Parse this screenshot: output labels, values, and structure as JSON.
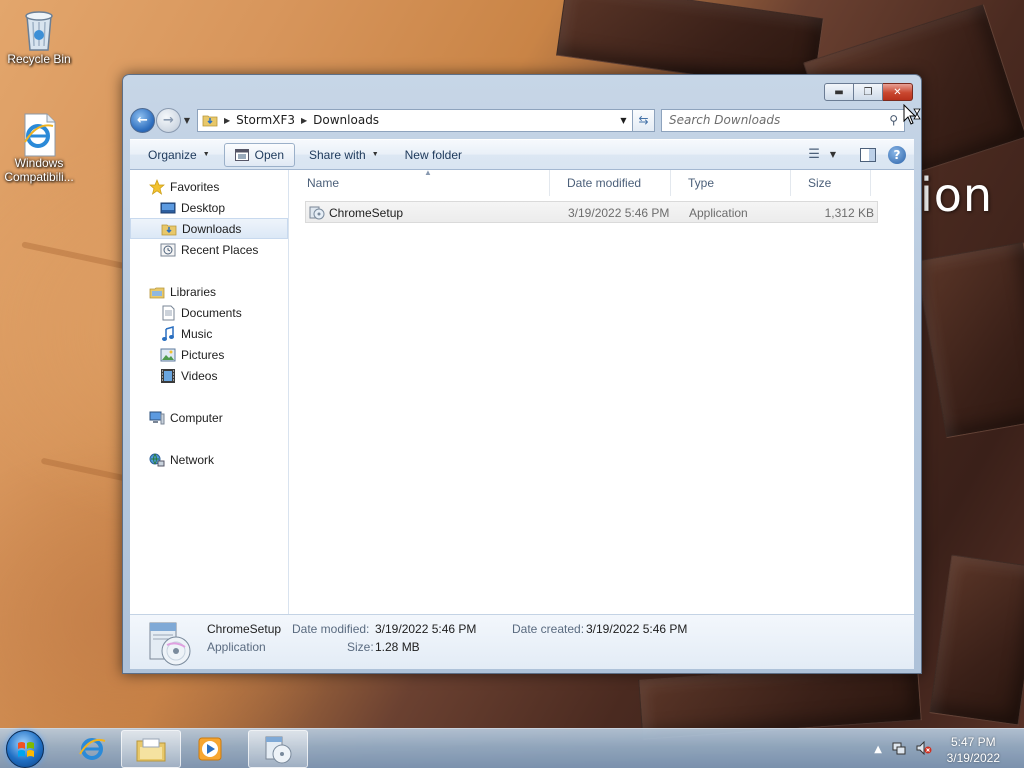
{
  "desktop": {
    "icons": [
      {
        "label": "Recycle Bin"
      },
      {
        "label": "Windows Compatibili..."
      }
    ],
    "overlay_text": "ion"
  },
  "window": {
    "caption_buttons": {
      "minimize": "minimize-icon",
      "maximize": "maximize-icon",
      "close": "close-icon"
    },
    "address": {
      "crumbs": [
        "StormXF3",
        "Downloads"
      ]
    },
    "search": {
      "placeholder": "Search Downloads"
    },
    "toolbar": {
      "organize": "Organize",
      "open": "Open",
      "share_with": "Share with",
      "new_folder": "New folder"
    },
    "nav_pane": {
      "favorites": {
        "label": "Favorites",
        "items": [
          "Desktop",
          "Downloads",
          "Recent Places"
        ]
      },
      "libraries": {
        "label": "Libraries",
        "items": [
          "Documents",
          "Music",
          "Pictures",
          "Videos"
        ]
      },
      "computer": "Computer",
      "network": "Network",
      "selected": "Downloads"
    },
    "columns": [
      "Name",
      "Date modified",
      "Type",
      "Size"
    ],
    "files": [
      {
        "name": "ChromeSetup",
        "date_modified": "3/19/2022 5:46 PM",
        "type": "Application",
        "size": "1,312 KB"
      }
    ],
    "details": {
      "name": "ChromeSetup",
      "type": "Application",
      "date_modified_label": "Date modified:",
      "date_modified": "3/19/2022 5:46 PM",
      "date_created_label": "Date created:",
      "date_created": "3/19/2022 5:46 PM",
      "size_label": "Size:",
      "size": "1.28 MB"
    }
  },
  "taskbar": {
    "time": "5:47 PM",
    "date": "3/19/2022"
  },
  "colors": {
    "accent": "#1f6fc4",
    "selection": "#dce8f6",
    "close_button": "#c9472f"
  }
}
